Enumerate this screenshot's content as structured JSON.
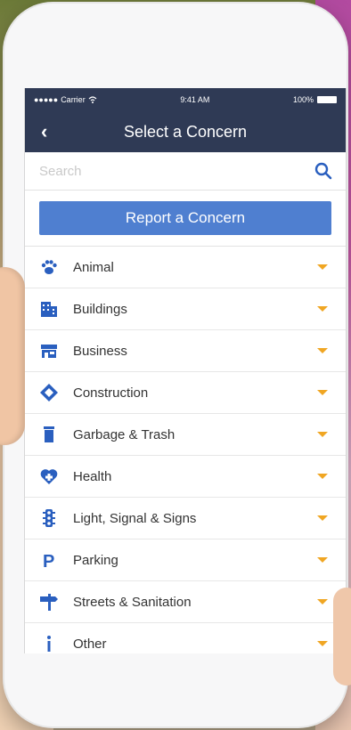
{
  "status": {
    "carrier": "Carrier",
    "time": "9:41 AM",
    "battery": "100%"
  },
  "nav": {
    "title": "Select a Concern",
    "back_icon": "chevron-left-icon"
  },
  "search": {
    "placeholder": "Search",
    "value": ""
  },
  "report_button": {
    "label": "Report a Concern"
  },
  "categories": [
    {
      "label": "Animal",
      "icon": "paw-icon"
    },
    {
      "label": "Buildings",
      "icon": "building-icon"
    },
    {
      "label": "Business",
      "icon": "storefront-icon"
    },
    {
      "label": "Construction",
      "icon": "diamond-sign-icon"
    },
    {
      "label": "Garbage & Trash",
      "icon": "trash-can-icon"
    },
    {
      "label": "Health",
      "icon": "heart-cross-icon"
    },
    {
      "label": "Light, Signal & Signs",
      "icon": "traffic-light-icon"
    },
    {
      "label": "Parking",
      "icon": "parking-icon"
    },
    {
      "label": "Streets & Sanitation",
      "icon": "street-sign-icon"
    },
    {
      "label": "Other",
      "icon": "info-icon"
    }
  ],
  "colors": {
    "nav_bg": "#2f3a55",
    "accent_blue": "#4f7fd0",
    "chevron": "#f0a623",
    "icon_blue": "#2a5fbf"
  }
}
